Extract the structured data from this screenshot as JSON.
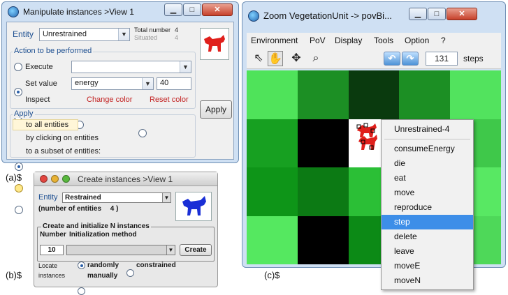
{
  "window_a": {
    "title": "Manipulate instances >View 1",
    "entity_label": "Entity",
    "entity_value": "Unrestrained",
    "total_label": "Total number",
    "total_value": "4",
    "situated_label": "Situated",
    "situated_value": "4",
    "action_legend": "Action to be performed",
    "execute_label": "Execute",
    "execute_value": "",
    "set_value_label": "Set value",
    "set_value_attr": "energy",
    "set_value_number": "40",
    "inspect_label": "Inspect",
    "change_color_label": "Change color",
    "reset_color_label": "Reset color",
    "apply_legend": "Apply",
    "apply_all_label": "to all entities",
    "apply_click_label": "by clicking on entities",
    "apply_subset_label": "to a subset of entities:",
    "apply_button": "Apply",
    "selected_action": "set_value",
    "selected_apply": "all",
    "icon_color": "#e0201c"
  },
  "window_b": {
    "title": "Create instances >View 1",
    "entity_label": "Entity",
    "entity_value": "Restrained",
    "count_label": "(number of entities",
    "count_value": "4",
    "count_close": ")",
    "group_legend": "Create and initialize N instances",
    "number_header": "Number",
    "method_header": "Initialization method",
    "number_value": "10",
    "method_value": "",
    "create_button": "Create",
    "locate_label": "Locate",
    "instances_label": "instances",
    "randomly_label": "randomly",
    "constrained_label": "constrained",
    "manually_label": "manually",
    "selected_locate": "randomly",
    "icon_color": "#1a2fd6"
  },
  "window_c": {
    "title": "Zoom VegetationUnit -> povBi...",
    "menus": [
      "Environment",
      "PoV",
      "Display",
      "Tools",
      "Option",
      "?"
    ],
    "steps_value": "131",
    "steps_label": "steps",
    "grid_colors": [
      [
        "#4fe35a",
        "#1c8f24",
        "#0a3a0e",
        "#1c8f24",
        "#52e35e"
      ],
      [
        "#17a021",
        "#000000",
        "#ffffff",
        "#13861c",
        "#3fc84a"
      ],
      [
        "#0e9518",
        "#0c7a14",
        "#2bbf36",
        "#0d8f17",
        "#58e863"
      ],
      [
        "#55e860",
        "#000000",
        "#0c8a16",
        "#2cc639",
        "#4ed859"
      ]
    ]
  },
  "context_menu": {
    "header": "Unrestrained-4",
    "items": [
      "consumeEnergy",
      "die",
      "eat",
      "move",
      "reproduce",
      "step",
      "delete",
      "leave",
      "moveE",
      "moveN"
    ],
    "selected": "step"
  },
  "captions": {
    "a": "(a)$",
    "b": "(b)$",
    "c": "(c)$"
  }
}
